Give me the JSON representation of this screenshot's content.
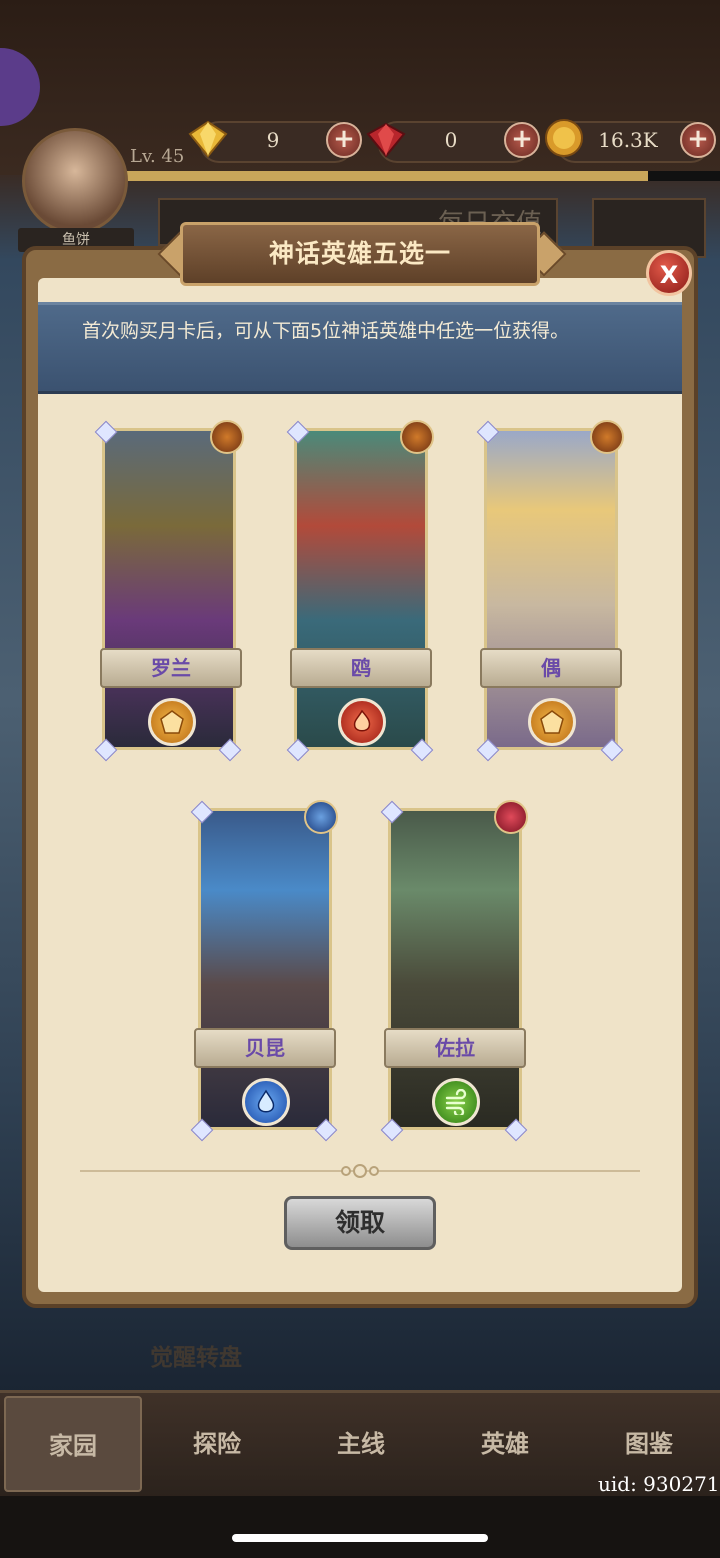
{
  "header": {
    "level": "Lv. 45",
    "player_name": "鱼饼",
    "daily_recharge": "每日充值",
    "resources": [
      {
        "icon": "gold-gem-icon",
        "value": "9"
      },
      {
        "icon": "red-gem-icon",
        "value": "0"
      },
      {
        "icon": "coin-icon",
        "value": "16.3K"
      }
    ],
    "plus_symbol": "+"
  },
  "dialog": {
    "title": "神话英雄五选一",
    "close_label": "X",
    "notice": "首次购买月卡后，可从下面5位神话英雄中任选一位获得。",
    "claim_label": "领取"
  },
  "heroes": [
    {
      "name": "罗兰",
      "element": "earth",
      "element_color": "#e39a2e",
      "faction": "fire-crest"
    },
    {
      "name": "鸥",
      "element": "fire",
      "element_color": "#d43d2c",
      "faction": "fire-crest"
    },
    {
      "name": "偶",
      "element": "earth",
      "element_color": "#e39a2e",
      "faction": "fire-crest"
    },
    {
      "name": "贝昆",
      "element": "water",
      "element_color": "#3a7ad8",
      "faction": "star-crest"
    },
    {
      "name": "佐拉",
      "element": "wind",
      "element_color": "#4fa23a",
      "faction": "demon-crest"
    }
  ],
  "background": {
    "awaken_wheel": "觉醒转盘"
  },
  "nav": [
    {
      "label": "家园",
      "active": true
    },
    {
      "label": "探险",
      "active": false
    },
    {
      "label": "主线",
      "active": false
    },
    {
      "label": "英雄",
      "active": false
    },
    {
      "label": "图鉴",
      "active": false
    }
  ],
  "uid": "uid: 930271"
}
